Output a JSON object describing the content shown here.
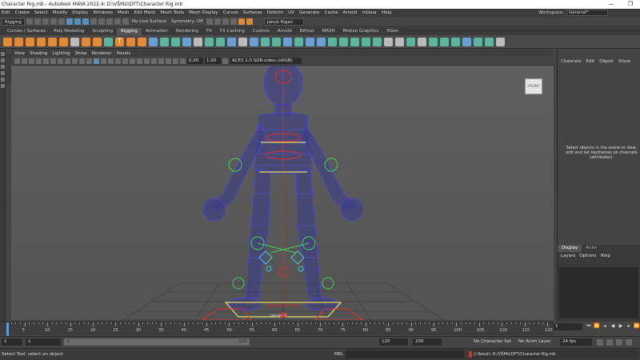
{
  "window": {
    "title": "Character Rig.mb - Autodesk MAYA 2022.4: D:\\VŠMU\\DFT\\Character Rig.mb",
    "min": "—",
    "max": "❐"
  },
  "menu": [
    "Edit",
    "Create",
    "Select",
    "Modify",
    "Display",
    "Windows",
    "Mesh",
    "Edit Mesh",
    "Mesh Tools",
    "Mesh Display",
    "Curves",
    "Surfaces",
    "Deform",
    "UV",
    "Generate",
    "Cache",
    "Arnold",
    "mGear",
    "Help"
  ],
  "workspace": {
    "label": "Workspace:",
    "value": "General*"
  },
  "statusline": {
    "mode": "Rigging",
    "surface": "No Live Surface",
    "symmetry": "Symmetry: Off",
    "user": "Jakub Rigan"
  },
  "shelf_tabs": [
    "Curves / Surfaces",
    "Poly Modeling",
    "Sculpting",
    "Rigging",
    "Animation",
    "Rendering",
    "FX",
    "FX Caching",
    "Custom",
    "Arnold",
    "Bifrost",
    "MASH",
    "Motion Graphics",
    "XGen"
  ],
  "shelf_active": "Rigging",
  "panel": {
    "menu": [
      "View",
      "Shading",
      "Lighting",
      "Show",
      "Renderer",
      "Panels"
    ],
    "near": "0.00",
    "far": "1.00",
    "colorspace": "ACES 1.0 SDR-video (sRGB)",
    "view_cube": "FRONT",
    "camera": "persp -2"
  },
  "channelbox": {
    "menu": [
      "Channels",
      "Edit",
      "Object",
      "Show"
    ],
    "message": "Select objects in the scene to view, edit and set keyframes on channels (attributes)."
  },
  "layers": {
    "tabs": [
      "Display",
      "Anim"
    ],
    "menu": [
      "Layers",
      "Options",
      "Help"
    ]
  },
  "timeline": {
    "ticks": [
      "5",
      "10",
      "15",
      "20",
      "25",
      "30",
      "35",
      "40",
      "45",
      "50",
      "55",
      "60",
      "65",
      "70",
      "75",
      "80",
      "85",
      "90",
      "95",
      "100",
      "105",
      "110",
      "115",
      "120"
    ],
    "current_frame": "1"
  },
  "range": {
    "start": "1",
    "start2": "1",
    "bar_start": "1",
    "bar_end": "120",
    "end": "120",
    "end2": "200",
    "character_set": "No Character Set",
    "anim_layer": "No Anim Layer",
    "fps": "24 fps"
  },
  "cmdline": {
    "help": "Select Tool: select an object",
    "mel": "MEL",
    "result": "// Result: D:/VŠMU/DFT/Character Rig.mb"
  }
}
